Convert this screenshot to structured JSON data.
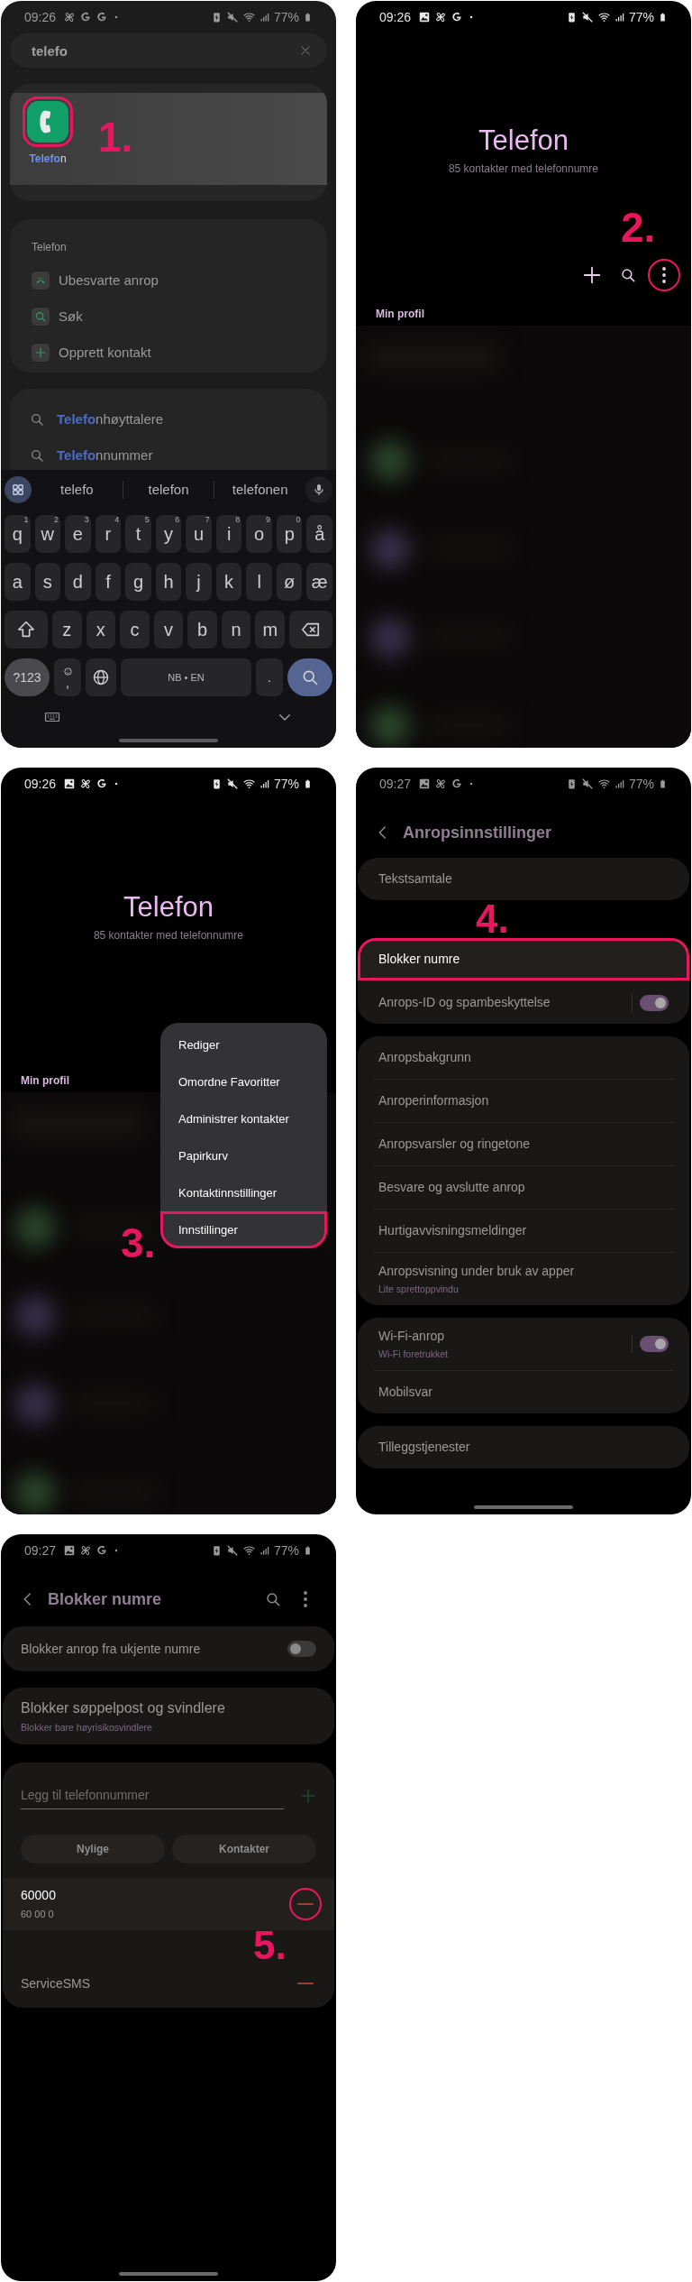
{
  "panels": [
    {
      "kind": "app_search",
      "status_bar": {
        "time": "09:26",
        "notifications": [
          {
            "kind": "fan"
          },
          {
            "kind": "google"
          },
          {
            "kind": "google"
          },
          {
            "kind": "dot"
          }
        ],
        "battery": "77%"
      },
      "search": {
        "value": "telefo"
      },
      "app_result": {
        "match": "Telefo",
        "rest": "n",
        "highlighted": true
      },
      "annotation": "1.",
      "section": {
        "title": "Telefon",
        "actions": [
          {
            "kind": "missed_call",
            "label": "Ubesvarte anrop"
          },
          {
            "kind": "search",
            "label": "Søk"
          },
          {
            "kind": "add",
            "label": "Opprett kontakt"
          }
        ]
      },
      "suggestions": [
        {
          "match": "Telefo",
          "rest": "nhøyttalere"
        },
        {
          "match": "Telefo",
          "rest": "nnummer"
        }
      ],
      "keyboard": {
        "predictions": [
          "telefo",
          "telefon",
          "telefonen"
        ],
        "rows": [
          {
            "keys": [
              {
                "kind": "letter",
                "label": "q",
                "hint": "1"
              },
              {
                "kind": "letter",
                "label": "w",
                "hint": "2"
              },
              {
                "kind": "letter",
                "label": "e",
                "hint": "3"
              },
              {
                "kind": "letter",
                "label": "r",
                "hint": "4"
              },
              {
                "kind": "letter",
                "label": "t",
                "hint": "5"
              },
              {
                "kind": "letter",
                "label": "y",
                "hint": "6"
              },
              {
                "kind": "letter",
                "label": "u",
                "hint": "7"
              },
              {
                "kind": "letter",
                "label": "i",
                "hint": "8"
              },
              {
                "kind": "letter",
                "label": "o",
                "hint": "9"
              },
              {
                "kind": "letter",
                "label": "p",
                "hint": "0"
              },
              {
                "kind": "letter",
                "label": "å"
              }
            ]
          },
          {
            "keys": [
              {
                "kind": "letter",
                "label": "a"
              },
              {
                "kind": "letter",
                "label": "s"
              },
              {
                "kind": "letter",
                "label": "d"
              },
              {
                "kind": "letter",
                "label": "f"
              },
              {
                "kind": "letter",
                "label": "g"
              },
              {
                "kind": "letter",
                "label": "h"
              },
              {
                "kind": "letter",
                "label": "j"
              },
              {
                "kind": "letter",
                "label": "k"
              },
              {
                "kind": "letter",
                "label": "l"
              },
              {
                "kind": "letter",
                "label": "ø"
              },
              {
                "kind": "letter",
                "label": "æ"
              }
            ]
          },
          {
            "keys": [
              {
                "kind": "shift"
              },
              {
                "kind": "letter",
                "label": "z"
              },
              {
                "kind": "letter",
                "label": "x"
              },
              {
                "kind": "letter",
                "label": "c"
              },
              {
                "kind": "letter",
                "label": "v"
              },
              {
                "kind": "letter",
                "label": "b"
              },
              {
                "kind": "letter",
                "label": "n"
              },
              {
                "kind": "letter",
                "label": "m"
              },
              {
                "kind": "backspace"
              }
            ]
          },
          {
            "keys": [
              {
                "kind": "symbols",
                "label": "?123"
              },
              {
                "kind": "emoji",
                "label": ","
              },
              {
                "kind": "globe"
              },
              {
                "kind": "space",
                "label": "NB • EN"
              },
              {
                "kind": "period",
                "label": "."
              },
              {
                "kind": "search"
              }
            ]
          }
        ]
      }
    },
    {
      "kind": "contacts",
      "status_bar": {
        "time": "09:26",
        "notifications": [
          {
            "kind": "image"
          },
          {
            "kind": "fan"
          },
          {
            "kind": "google"
          },
          {
            "kind": "dot"
          }
        ],
        "battery": "77%"
      },
      "title": "Telefon",
      "subtitle": "85 kontakter med telefonnumre",
      "annotation": "2.",
      "actions": [
        {
          "kind": "add",
          "highlighted": false
        },
        {
          "kind": "search",
          "highlighted": false
        },
        {
          "kind": "more",
          "highlighted": true
        }
      ],
      "section_label": "Min profil"
    },
    {
      "kind": "contacts",
      "status_bar": {
        "time": "09:26",
        "notifications": [
          {
            "kind": "image"
          },
          {
            "kind": "fan"
          },
          {
            "kind": "google"
          },
          {
            "kind": "dot"
          }
        ],
        "battery": "77%"
      },
      "title": "Telefon",
      "subtitle": "85 kontakter med telefonnumre",
      "annotation": "3.",
      "section_label": "Min profil",
      "menu": [
        {
          "label": "Rediger",
          "highlighted": false
        },
        {
          "label": "Omordne Favoritter",
          "highlighted": false
        },
        {
          "label": "Administrer kontakter",
          "highlighted": false
        },
        {
          "label": "Papirkurv",
          "highlighted": false
        },
        {
          "label": "Kontaktinnstillinger",
          "highlighted": false
        },
        {
          "label": "Innstillinger",
          "highlighted": true
        }
      ]
    },
    {
      "kind": "settings",
      "status_bar": {
        "time": "09:27",
        "notifications": [
          {
            "kind": "image"
          },
          {
            "kind": "fan"
          },
          {
            "kind": "google"
          },
          {
            "kind": "dot"
          }
        ],
        "battery": "77%"
      },
      "title": "Anropsinnstillinger",
      "annotation": "4.",
      "groups": [
        [
          {
            "label": "Tekstsamtale",
            "highlighted": false
          }
        ],
        [
          {
            "label": "Blokker numre",
            "highlighted": true
          },
          {
            "label": "Anrops-ID og spambeskyttelse",
            "highlighted": false,
            "on": true
          }
        ],
        [
          {
            "label": "Anropsbakgrunn",
            "highlighted": false
          },
          {
            "label": "Anroperinformasjon",
            "highlighted": false
          },
          {
            "label": "Anropsvarsler og ringetone",
            "highlighted": false
          },
          {
            "label": "Besvare og avslutte anrop",
            "highlighted": false
          },
          {
            "label": "Hurtigavvisningsmeldinger",
            "highlighted": false
          },
          {
            "label": "Anropsvisning under bruk av apper",
            "sublabel": "Lite sprettoppvindu",
            "highlighted": false
          }
        ],
        [
          {
            "label": "Wi-Fi-anrop",
            "sublabel": "Wi-Fi foretrukket",
            "highlighted": false,
            "on": true
          },
          {
            "label": "Mobilsvar",
            "highlighted": false
          }
        ],
        [
          {
            "label": "Tilleggstjenester",
            "highlighted": false
          }
        ]
      ]
    },
    {
      "kind": "block_list",
      "status_bar": {
        "time": "09:27",
        "notifications": [
          {
            "kind": "image"
          },
          {
            "kind": "fan"
          },
          {
            "kind": "google"
          },
          {
            "kind": "dot"
          }
        ],
        "battery": "77%"
      },
      "title": "Blokker numre",
      "annotation": "5.",
      "unknown_toggle": {
        "label": "Blokker anrop fra ukjente numre",
        "on": false
      },
      "spam": {
        "label": "Blokker søppelpost og svindlere",
        "sublabel": "Blokker bare høyrisikosvindlere"
      },
      "input": {
        "placeholder": "Legg til telefonnummer"
      },
      "buttons": [
        "Nylige",
        "Kontakter"
      ],
      "blocked": [
        {
          "name": "60000",
          "number": "60 00 0",
          "selected": true,
          "highlighted": true
        },
        {
          "name": "ServiceSMS",
          "selected": false,
          "highlighted": false
        }
      ]
    }
  ]
}
